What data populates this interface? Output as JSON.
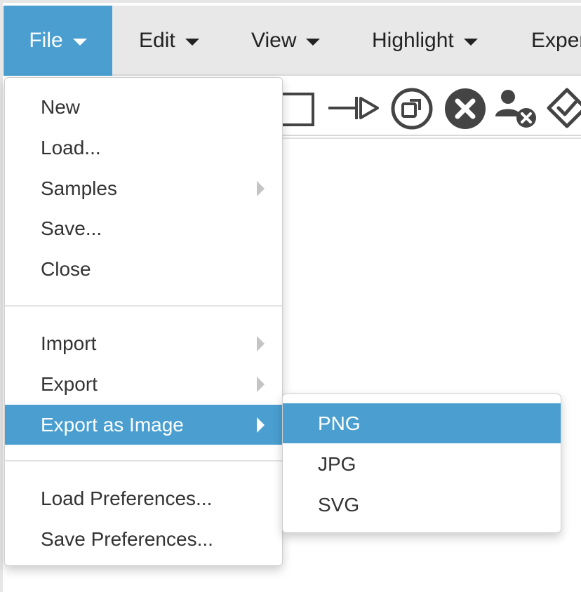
{
  "menubar": {
    "items": [
      {
        "label": "File"
      },
      {
        "label": "Edit"
      },
      {
        "label": "View"
      },
      {
        "label": "Highlight"
      },
      {
        "label": "Exper"
      }
    ]
  },
  "toolbar": {
    "tools": [
      {
        "icon": "rectangle-icon"
      },
      {
        "icon": "inhibition-arc-icon"
      },
      {
        "icon": "resize-icon"
      },
      {
        "icon": "close-circle-icon"
      },
      {
        "icon": "remove-user-icon"
      },
      {
        "icon": "check-diamond-icon"
      }
    ]
  },
  "file_menu": {
    "new": "New",
    "load": "Load...",
    "samples": "Samples",
    "save": "Save...",
    "close": "Close",
    "import": "Import",
    "export": "Export",
    "export_image": "Export as Image",
    "load_prefs": "Load Preferences...",
    "save_prefs": "Save Preferences..."
  },
  "export_image_menu": {
    "png": "PNG",
    "jpg": "JPG",
    "svg": "SVG"
  },
  "colors": {
    "accent": "#4a9fd0",
    "menubar_bg": "#e8e8e8",
    "icon": "#444444"
  }
}
